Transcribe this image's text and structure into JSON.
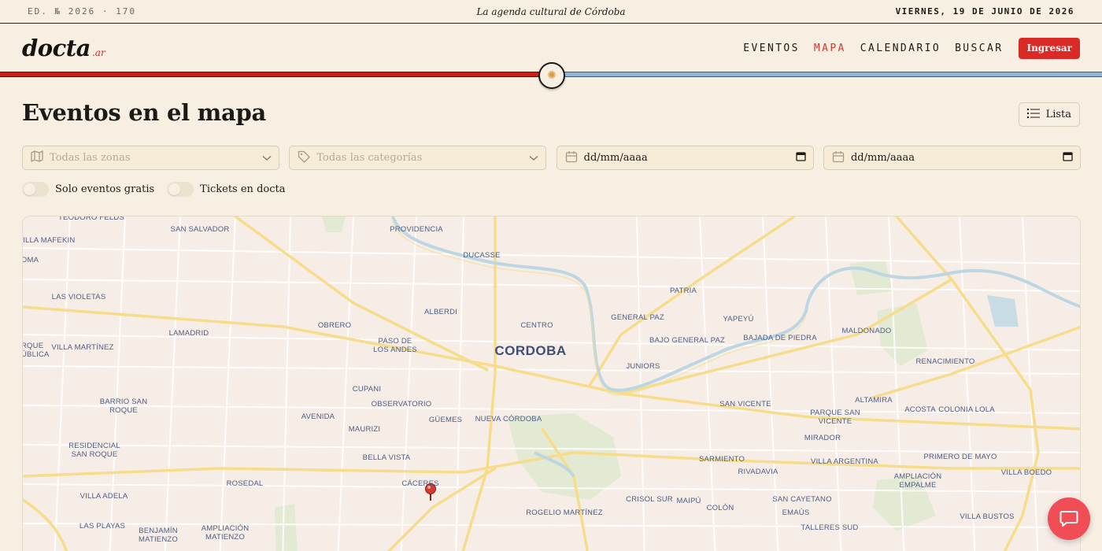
{
  "topbar": {
    "edition": "ED. № 2026 · 170",
    "tagline": "La agenda cultural de Córdoba",
    "date": "VIERNES, 19 DE JUNIO DE 2026"
  },
  "brand": {
    "name": "docta",
    "tld": ".ar"
  },
  "nav": {
    "items": [
      {
        "label": "EVENTOS",
        "active": false
      },
      {
        "label": "MAPA",
        "active": true
      },
      {
        "label": "CALENDARIO",
        "active": false
      },
      {
        "label": "BUSCAR",
        "active": false
      }
    ],
    "login_label": "Ingresar"
  },
  "page": {
    "title": "Eventos en el mapa",
    "list_button": "Lista"
  },
  "filters": {
    "zones_placeholder": "Todas las zonas",
    "categories_placeholder": "Todas las categorías",
    "date_from": "dd/mm/aaaa",
    "date_to": "dd/mm/aaaa"
  },
  "toggles": {
    "free_only": {
      "label": "Solo eventos gratis",
      "on": false
    },
    "docta_tickets": {
      "label": "Tickets en docta",
      "on": false
    }
  },
  "map": {
    "city_label": "CORDOBA",
    "neighborhoods": [
      "TEODORO FELDS",
      "SAN SALVADOR",
      "VILLA MAFEKIN",
      "OMA",
      "PROVIDENCIA",
      "DUCASSE",
      "LAS VIOLETAS",
      "ALBERDI",
      "PATRIA",
      "OBRERO",
      "CENTRO",
      "GENERAL PAZ",
      "YAPEYÚ",
      "MALDONADO",
      "LAMADRID",
      "PASO DE LOS ANDES",
      "BAJO GENERAL PAZ",
      "BAJADA DE PIEDRA",
      "RQUE ÚBLICA",
      "VILLA MARTÍNEZ",
      "JUNIORS",
      "RENACIMIENTO",
      "CUPANI",
      "ALTAMIRA",
      "BARRIO SAN ROQUE",
      "OBSERVATORIO",
      "SAN VICENTE",
      "ACOSTA",
      "COLONIA LOLA",
      "AVENIDA",
      "GÜEMES",
      "NUEVA CÓRDOBA",
      "PARQUE SAN VICENTE",
      "MAURIZI",
      "MIRADOR",
      "RESIDENCIAL SAN ROQUE",
      "BELLA VISTA",
      "SARMIENTO",
      "VILLA ARGENTINA",
      "PRIMERO DE MAYO",
      "ROSEDAL",
      "CÁCERES",
      "RIVADAVIA",
      "AMPLIACIÓN EMPALME",
      "VILLA BOEDO",
      "VILLA ADELA",
      "CRISOL SUR",
      "MAIPÚ",
      "SAN CAYETANO",
      "COLÓN",
      "ROGELIO MARTÍNEZ",
      "EMAÚS",
      "LAS PLAYAS",
      "BENJAMÍN MATIENZO",
      "AMPLIACIÓN MATIENZO",
      "TALLERES SUD",
      "VILLA BUSTOS"
    ],
    "markers": 1
  },
  "icons": {
    "map": "map-icon",
    "tag": "tag-icon",
    "calendar": "calendar-icon",
    "chevron": "chevron-down-icon",
    "list": "list-icon",
    "chat": "chat-icon",
    "pin": "map-pin-icon"
  },
  "colors": {
    "background": "#f7efe1",
    "accent_red": "#d92a26",
    "stripe_blue": "#8fb7da",
    "chat_button": "#f04d56"
  }
}
